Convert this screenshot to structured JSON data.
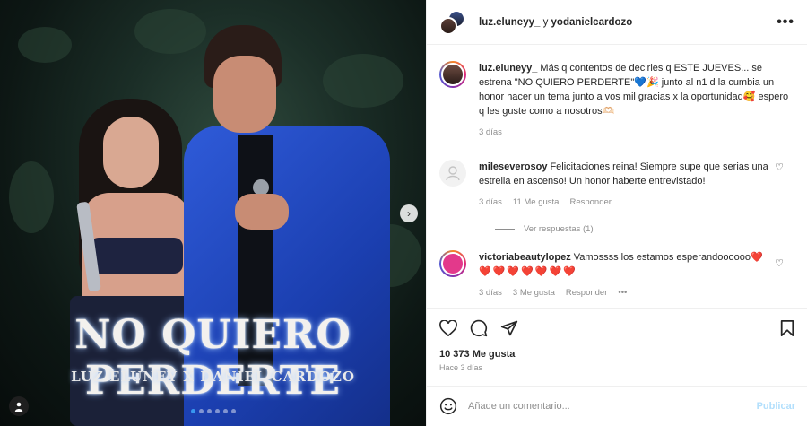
{
  "post": {
    "poster_title": "NO QUIERO PERDERTE",
    "poster_subtitle": "LUZ ELUNEY X DANIEL CARDOZO",
    "carousel_dots": 6,
    "active_dot": 0
  },
  "header": {
    "user1": "luz.eluneyy_",
    "joiner": " y ",
    "user2": "yodanielcardozo",
    "more_icon": "more-horizontal-icon"
  },
  "caption": {
    "username": "luz.eluneyy_",
    "text": "Más q contentos de decirles q ESTE JUEVES... se estrena \"NO QUIERO PERDERTE\"💙🎉 junto al n1 d la cumbia un honor hacer un tema junto a vos mil gracias x la oportunidad🥰 espero q les guste como a nosotros🫶🏻",
    "time": "3 días"
  },
  "comments": [
    {
      "username": "mileseverosoy",
      "text": "Felicitaciones reina! Siempre supe que serias una estrella en ascenso! Un honor haberte entrevistado!",
      "time": "3 días",
      "likes": "11 Me gusta",
      "reply": "Responder",
      "view_replies": "Ver respuestas (1)"
    },
    {
      "username": "victoriabeautylopez",
      "text": "Vamossss los estamos esperandoooooo❤️",
      "hearts": "❤️❤️❤️❤️❤️❤️❤️",
      "time": "3 días",
      "likes": "3 Me gusta",
      "reply": "Responder",
      "more": "•••"
    }
  ],
  "actions": {
    "likes": "10 373 Me gusta",
    "ago": "Hace 3 días"
  },
  "composer": {
    "placeholder": "Añade un comentario...",
    "publish": "Publicar"
  },
  "colors": {
    "link_blue": "#3897f0",
    "publish_disabled": "#b2dffc",
    "like_red": "#ed4956"
  }
}
